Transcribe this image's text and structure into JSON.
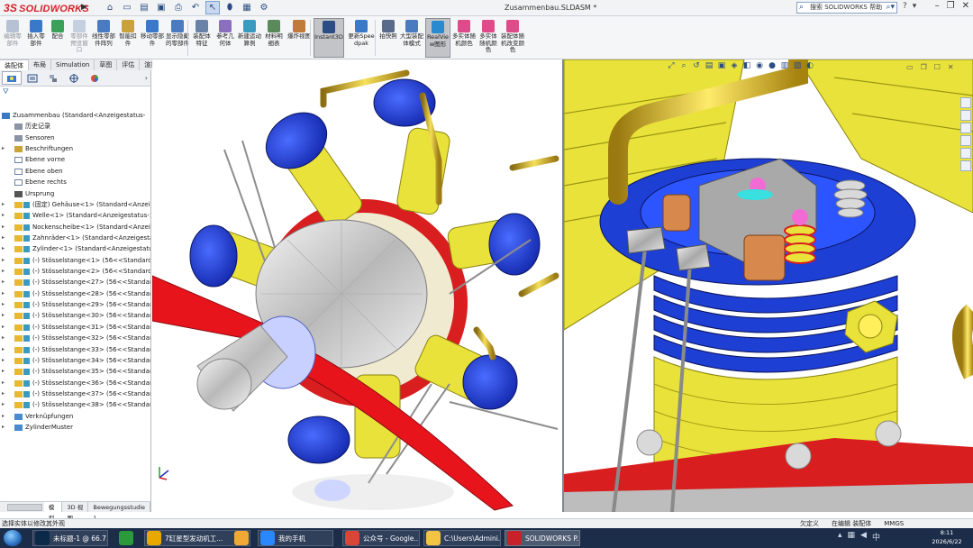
{
  "app": {
    "logo": "SOLIDWORKS",
    "doc_title": "Zusammenbau.SLDASM *"
  },
  "search": {
    "placeholder": "搜索 SOLIDWORKS 帮助"
  },
  "ribbon": [
    {
      "label": "编辑零部件",
      "dim": true
    },
    {
      "label": "插入零部件"
    },
    {
      "label": "配合"
    },
    {
      "label": "零部件预览窗口",
      "dim": true
    },
    {
      "label": "线性零部件阵列"
    },
    {
      "label": "智能扣件"
    },
    {
      "label": "移动零部件"
    },
    {
      "label": "显示隐藏的零部件"
    },
    {
      "label": "装配体特征"
    },
    {
      "label": "参考几何体"
    },
    {
      "label": "新建运动算例"
    },
    {
      "label": "材料明细表"
    },
    {
      "label": "爆炸视图"
    },
    {
      "label": "Instant3D",
      "active": true
    },
    {
      "label": "更新Speedpak"
    },
    {
      "label": "拍快照"
    },
    {
      "label": "大型装配体模式"
    },
    {
      "label": "RealView图形",
      "active": true
    },
    {
      "label": "多实体随机颜色"
    },
    {
      "label": "多实体随机颜色"
    },
    {
      "label": "装配体随机改变颜色"
    }
  ],
  "tabs": [
    "装配体",
    "布局",
    "Simulation",
    "草图",
    "评估",
    "渲染工具",
    "直接编辑",
    "MBD",
    "SOLIDWORKS 插件"
  ],
  "tree": [
    {
      "text": "Zusammenbau  (Standard<Anzeigestatus-",
      "type": "asm",
      "expand": false,
      "indent": 0
    },
    {
      "text": "历史记录",
      "type": "doc",
      "indent": 1
    },
    {
      "text": "Sensoren",
      "type": "doc",
      "indent": 1
    },
    {
      "text": "Beschriftungen",
      "type": "note",
      "expand": true,
      "indent": 1
    },
    {
      "text": "Ebene vorne",
      "type": "plane",
      "indent": 1
    },
    {
      "text": "Ebene oben",
      "type": "plane",
      "indent": 1
    },
    {
      "text": "Ebene rechts",
      "type": "plane",
      "indent": 1
    },
    {
      "text": "Ursprung",
      "type": "origin",
      "indent": 1
    },
    {
      "text": "(固定) Gehäuse<1> (Standard<Anzeigestat",
      "type": "part",
      "expand": true,
      "indent": 1
    },
    {
      "text": "Welle<1> (Standard<Anzeigestatus-1>)",
      "type": "part",
      "expand": true,
      "indent": 1
    },
    {
      "text": "Nockenscheibe<1> (Standard<Anzeigesta",
      "type": "part",
      "expand": true,
      "indent": 1
    },
    {
      "text": "Zahnräder<1> (Standard<Anzeigestat",
      "type": "part",
      "expand": true,
      "indent": 1
    },
    {
      "text": "Zylinder<1> (Standard<Anzeigestatus-1>)",
      "type": "part",
      "expand": true,
      "indent": 1
    },
    {
      "text": "(-) Stösselstange<1> (56<<Standard>",
      "type": "part",
      "expand": true,
      "indent": 1
    },
    {
      "text": "(-) Stösselstange<2> (56<<Standard>",
      "type": "part",
      "expand": true,
      "indent": 1
    },
    {
      "text": "(-) Stösselstange<27> (56<<Standard",
      "type": "part",
      "expand": true,
      "indent": 1
    },
    {
      "text": "(-) Stösselstange<28> (56<<Standard",
      "type": "part",
      "expand": true,
      "indent": 1
    },
    {
      "text": "(-) Stösselstange<29> (56<<Standard",
      "type": "part",
      "expand": true,
      "indent": 1
    },
    {
      "text": "(-) Stösselstange<30> (56<<Standard",
      "type": "part",
      "expand": true,
      "indent": 1
    },
    {
      "text": "(-) Stösselstange<31> (56<<Standard",
      "type": "part",
      "expand": true,
      "indent": 1
    },
    {
      "text": "(-) Stösselstange<32> (56<<Standard",
      "type": "part",
      "expand": true,
      "indent": 1
    },
    {
      "text": "(-) Stösselstange<33> (56<<Standard",
      "type": "part",
      "expand": true,
      "indent": 1
    },
    {
      "text": "(-) Stösselstange<34> (56<<Standard",
      "type": "part",
      "expand": true,
      "indent": 1
    },
    {
      "text": "(-) Stösselstange<35> (56<<Standard",
      "type": "part",
      "expand": true,
      "indent": 1
    },
    {
      "text": "(-) Stösselstange<36> (56<<Standard",
      "type": "part",
      "expand": true,
      "indent": 1
    },
    {
      "text": "(-) Stösselstange<37> (56<<Standard",
      "type": "part",
      "expand": true,
      "indent": 1
    },
    {
      "text": "(-) Stösselstange<38> (56<<Standard",
      "type": "part",
      "expand": true,
      "indent": 1
    },
    {
      "text": "Verknüpfungen",
      "type": "mate",
      "expand": true,
      "indent": 1
    },
    {
      "text": "ZylinderMuster",
      "type": "pattern",
      "expand": true,
      "indent": 1
    }
  ],
  "bottom_tabs": [
    "模型",
    "3D 视图",
    "Bewegungsstudie 1"
  ],
  "status": {
    "message": "选择实体以修改其外观",
    "custom": "欠定义",
    "editing": "在编辑 装配体",
    "units": "MMGS"
  },
  "taskbar": [
    {
      "label": "未标题-1 @ 66.7...",
      "color": "#0b2a4a"
    },
    {
      "label": "7缸星型发动机工...",
      "color": "#e8a800"
    },
    {
      "label": "我的手机",
      "color": "#2a88ff"
    },
    {
      "label": "公众号 - Google...",
      "color": "#db4437"
    },
    {
      "label": "C:\\Users\\Admini...",
      "color": "#f3c343"
    },
    {
      "label": "SOLIDWORKS P...",
      "color": "#c8212a"
    }
  ],
  "clock": {
    "time": "8:11",
    "date": "2026/6/22"
  },
  "colors": {
    "accent": "#2b4d83",
    "brand": "#d8212a",
    "engine_blue": "#1e3fd4",
    "engine_yellow": "#e9e23a",
    "engine_red": "#d81e1e"
  }
}
